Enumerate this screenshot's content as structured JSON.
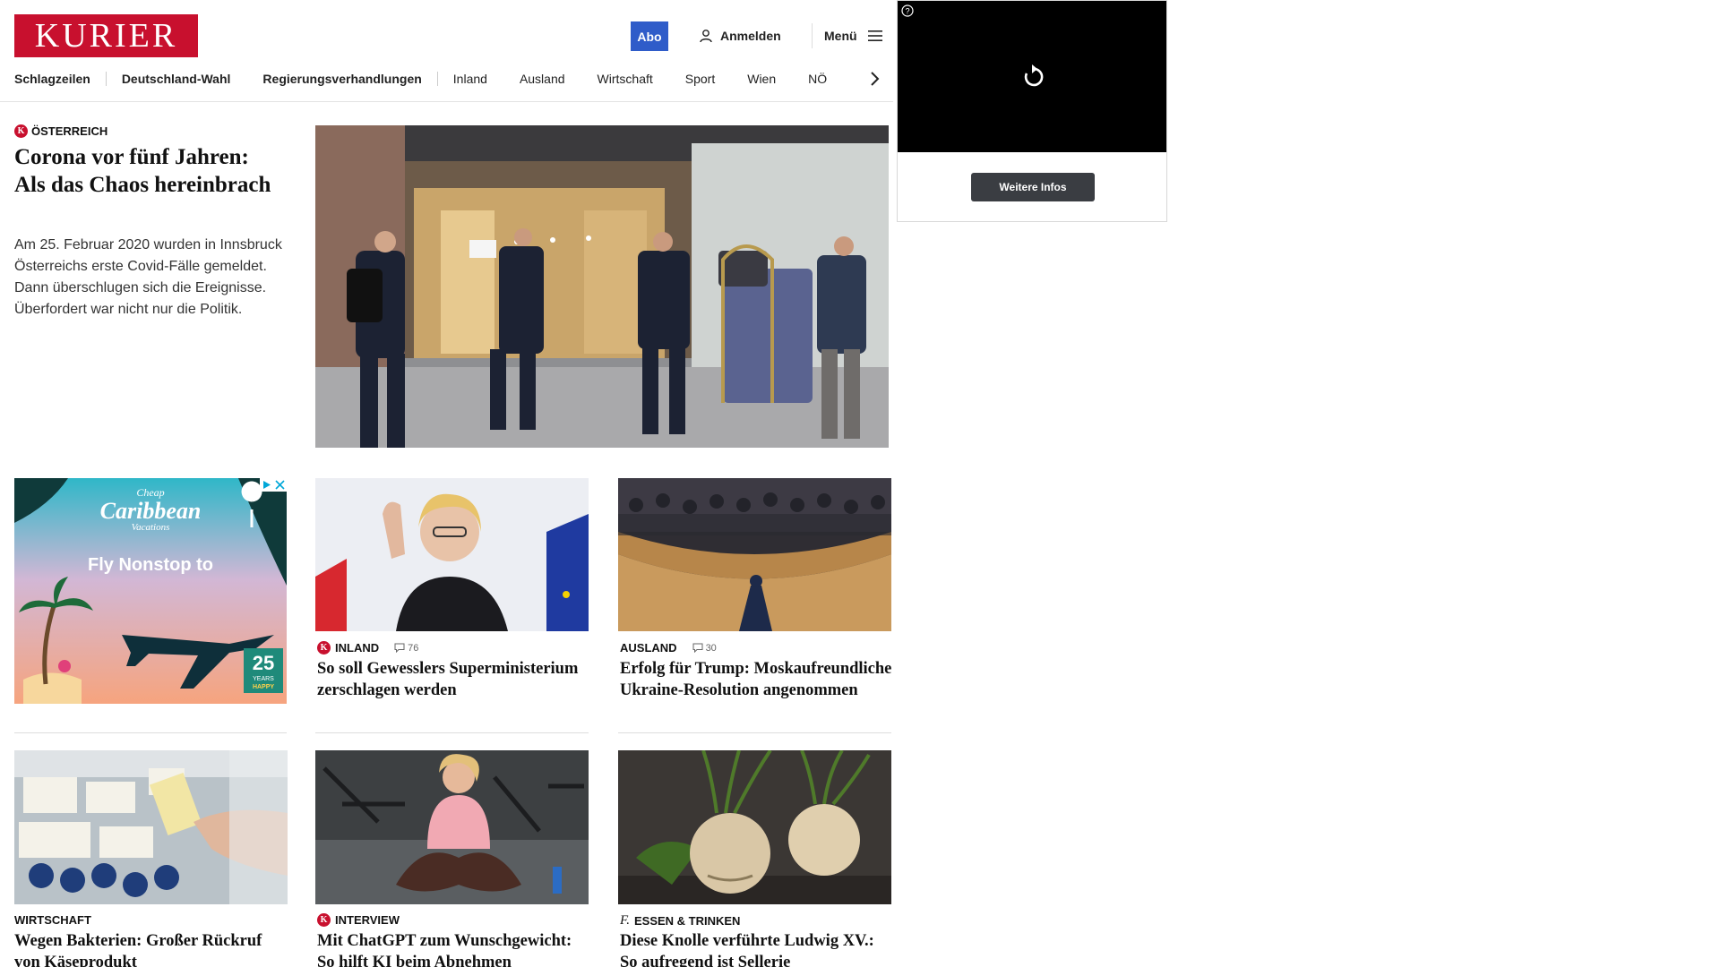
{
  "header": {
    "logo_text": "KURIER",
    "abo_label": "Abo",
    "login_label": "Anmelden",
    "menu_label": "Menü",
    "nav": [
      {
        "label": "Schlagzeilen"
      },
      {
        "label": "Deutschland-Wahl"
      },
      {
        "label": "Regierungsverhandlungen"
      },
      {
        "label": "Inland"
      },
      {
        "label": "Ausland"
      },
      {
        "label": "Wirtschaft"
      },
      {
        "label": "Sport"
      },
      {
        "label": "Wien"
      },
      {
        "label": "NÖ"
      }
    ]
  },
  "ad_right": {
    "button_label": "Weitere Infos"
  },
  "ad_left": {
    "brand_line1": "Cheap",
    "brand_line2": "Caribbean",
    "brand_line3": "Vacations",
    "headline": "Fly Nonstop to",
    "badge_number": "25",
    "badge_text1": "YEARS",
    "badge_text2": "HAPPY"
  },
  "hero": {
    "kicker": "Österreich",
    "title": "Corona vor fünf Jahren: Als das Chaos hereinbrach",
    "text": "Am 25. Februar 2020 wurden in Innsbruck Österreichs erste Covid-Fälle gemeldet. Dann überschlugen sich die Ereignisse. Überfordert war nicht nur die Politik."
  },
  "cards": [
    {
      "kicker": "Inland",
      "comments": "76",
      "title": "So soll Gewesslers Superministerium zerschlagen werden"
    },
    {
      "kicker": "Ausland",
      "comments": "30",
      "title": "Erfolg für Trump: Moskaufreundliche Ukraine-Resolution angenommen"
    },
    {
      "kicker": "Wirtschaft",
      "title": "Wegen Bakterien: Großer Rückruf von Käseprodukt"
    },
    {
      "kicker": "Interview",
      "title": "Mit ChatGPT zum Wunschgewicht: So hilft KI beim Abnehmen"
    },
    {
      "kicker": "Essen & Trinken",
      "title": "Diese Knolle verführte Ludwig XV.: So aufregend ist Sellerie"
    }
  ],
  "colors": {
    "brand": "#c8102e",
    "abo": "#2f5cc9"
  },
  "icons": [
    "user-icon",
    "menu-icon",
    "chevron-right-icon",
    "replay-icon",
    "help-icon",
    "comment-icon",
    "kurier-k-icon",
    "fine-dining-f-icon",
    "adchoices-icon",
    "close-icon"
  ]
}
